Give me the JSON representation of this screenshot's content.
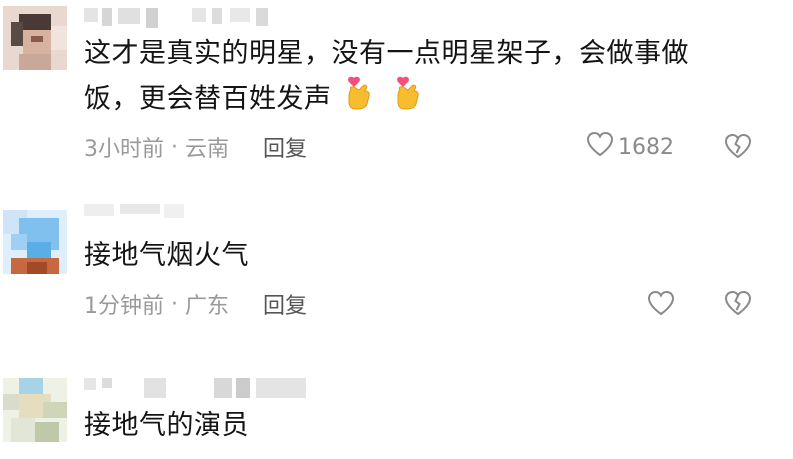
{
  "comments": [
    {
      "text_line1": "这才是真实的明星，没有一点明星架子，会做事做",
      "text_line2": "饭，更会替百姓发声",
      "time": "3小时前",
      "location": "云南",
      "reply": "回复",
      "likes": "1682",
      "emoji_name": "finger-heart-icon"
    },
    {
      "text_line1": "接地气烟火气",
      "time": "1分钟前",
      "location": "广东",
      "reply": "回复",
      "likes": ""
    },
    {
      "text_line1": "接地气的演员"
    }
  ],
  "colors": {
    "text": "#141414",
    "meta": "#9a9a9a",
    "icon": "#8a8a8a"
  }
}
